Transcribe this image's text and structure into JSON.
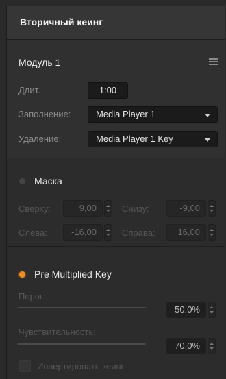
{
  "panel": {
    "title": "Вторичный кеинг"
  },
  "module": {
    "label": "Модуль 1",
    "duration_label": "Длит.",
    "duration_value": "1:00",
    "fill_label": "Заполнение:",
    "fill_value": "Media Player 1",
    "cut_label": "Удаление:",
    "cut_value": "Media Player 1 Key"
  },
  "mask": {
    "title": "Маска",
    "enabled": false,
    "top_label": "Сверху:",
    "top_value": "9,00",
    "bottom_label": "Снизу:",
    "bottom_value": "-9,00",
    "left_label": "Слева:",
    "left_value": "-16,00",
    "right_label": "Справа:",
    "right_value": "16,00"
  },
  "premultiplied": {
    "title": "Pre Multiplied Key",
    "enabled": true,
    "clip_label": "Порог:",
    "clip_value": "50,0%",
    "clip_level": 0.5,
    "gain_label": "Чувствительность:",
    "gain_value": "70,0%",
    "gain_level": 0.7,
    "invert_label": "Инвертировать кеинг"
  },
  "colors": {
    "accent": "#f08a24",
    "bg": "#2e2e2e",
    "field": "#1b1b1b"
  },
  "icons": {
    "menu": "hamburger-icon",
    "dropdown": "chevron-down-icon",
    "stepper": "up-down-stepper-icon"
  }
}
